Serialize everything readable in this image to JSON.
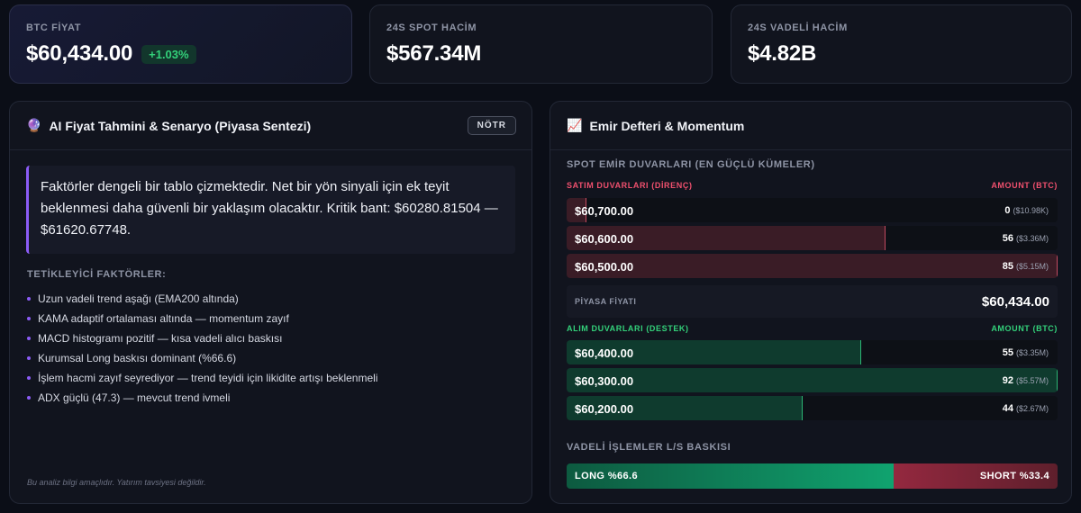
{
  "stats": [
    {
      "label": "BTC FİYAT",
      "value": "$60,434.00",
      "change": "+1.03%"
    },
    {
      "label": "24S SPOT HACİM",
      "value": "$567.34M"
    },
    {
      "label": "24S VADELİ HACİM",
      "value": "$4.82B"
    }
  ],
  "ai_panel": {
    "icon": "🔮",
    "icon_name": "crystal-ball-icon",
    "title": "AI Fiyat Tahmini & Senaryo (Piyasa Sentezi)",
    "badge": "NÖTR",
    "summary": "Faktörler dengeli bir tablo çizmektedir. Net bir yön sinyali için ek teyit beklenmesi daha güvenli bir yaklaşım olacaktır. Kritik bant: $60280.81504 — $61620.67748.",
    "factors_title": "TETİKLEYİCİ FAKTÖRLER:",
    "factors": [
      "Uzun vadeli trend aşağı (EMA200 altında)",
      "KAMA adaptif ortalaması altında — momentum zayıf",
      "MACD histogramı pozitif — kısa vadeli alıcı baskısı",
      "Kurumsal Long baskısı dominant (%66.6)",
      "İşlem hacmi zayıf seyrediyor — trend teyidi için likidite artışı beklenmeli",
      "ADX güçlü (47.3) — mevcut trend ivmeli"
    ],
    "disclaimer": "Bu analiz bilgi amaçlıdır. Yatırım tavsiyesi değildir."
  },
  "order_panel": {
    "icon": "📈",
    "icon_name": "chart-increasing-icon",
    "title": "Emir Defteri & Momentum",
    "walls_title": "SPOT EMİR DUVARLARI (EN GÜÇLÜ KÜMELER)",
    "ask_title": "SATIM DUVARLARI (DİRENÇ)",
    "ask_amount_header": "AMOUNT (BTC)",
    "asks": [
      {
        "price": "$60,700.00",
        "amount": "0",
        "usd": "($10.98K)",
        "fill": 0.04
      },
      {
        "price": "$60,600.00",
        "amount": "56",
        "usd": "($3.36M)",
        "fill": 0.65
      },
      {
        "price": "$60,500.00",
        "amount": "85",
        "usd": "($5.15M)",
        "fill": 1.0
      }
    ],
    "market_label": "PİYASA FİYATI",
    "market_price": "$60,434.00",
    "bid_title": "ALIM DUVARLARI (DESTEK)",
    "bid_amount_header": "AMOUNT (BTC)",
    "bids": [
      {
        "price": "$60,400.00",
        "amount": "55",
        "usd": "($3.35M)",
        "fill": 0.6
      },
      {
        "price": "$60,300.00",
        "amount": "92",
        "usd": "($5.57M)",
        "fill": 1.0
      },
      {
        "price": "$60,200.00",
        "amount": "44",
        "usd": "($2.67M)",
        "fill": 0.48
      }
    ],
    "ls_title": "VADELİ İŞLEMLER L/S BASKISI",
    "long_label": "LONG %66.6",
    "short_label": "SHORT %33.4",
    "long_pct": 66.6
  },
  "colors": {
    "accent": "#8b5cf6",
    "up": "#33d17a",
    "down": "#f0506e"
  }
}
